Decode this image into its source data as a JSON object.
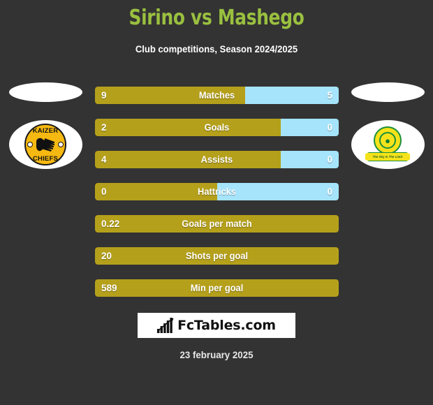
{
  "header": {
    "title": "Sirino vs Mashego",
    "subtitle": "Club competitions, Season 2024/2025"
  },
  "teams": {
    "home": {
      "name": "Kaizer Chiefs",
      "crest_top": "KAIZER",
      "crest_bottom": "CHIEFS",
      "colors": {
        "primary": "#f6b911",
        "secondary": "#111111"
      }
    },
    "away": {
      "name": "Mamelodi Sundowns",
      "crest_motto": "The Sky Is The Limit",
      "colors": {
        "primary": "#f5e21a",
        "secondary": "#1a8f3c"
      }
    }
  },
  "colors": {
    "background": "#333333",
    "title": "#9ac03f",
    "bar_left": "#b5a01b",
    "bar_right": "#a5e4fb",
    "text": "#ffffff"
  },
  "chart_data": {
    "type": "bar",
    "title": "Sirino vs Mashego",
    "subtitle": "Club competitions, Season 2024/2025",
    "orientation": "horizontal-diverging",
    "series": [
      {
        "name": "Sirino",
        "color": "#b5a01b"
      },
      {
        "name": "Mashego",
        "color": "#a5e4fb"
      }
    ],
    "categories": [
      "Matches",
      "Goals",
      "Assists",
      "Hattricks",
      "Goals per match",
      "Shots per goal",
      "Min per goal"
    ],
    "rows": [
      {
        "label": "Matches",
        "left": "9",
        "right": "5",
        "left_pct": 61.6,
        "dual": true
      },
      {
        "label": "Goals",
        "left": "2",
        "right": "0",
        "left_pct": 76.2,
        "dual": true
      },
      {
        "label": "Assists",
        "left": "4",
        "right": "0",
        "left_pct": 76.2,
        "dual": true
      },
      {
        "label": "Hattricks",
        "left": "0",
        "right": "0",
        "left_pct": 50.0,
        "dual": true
      },
      {
        "label": "Goals per match",
        "left": "0.22",
        "right": "",
        "left_pct": 100,
        "dual": false
      },
      {
        "label": "Shots per goal",
        "left": "20",
        "right": "",
        "left_pct": 100,
        "dual": false
      },
      {
        "label": "Min per goal",
        "left": "589",
        "right": "",
        "left_pct": 100,
        "dual": false
      }
    ]
  },
  "footer": {
    "brand": "FcTables.com",
    "date": "23 february 2025"
  }
}
